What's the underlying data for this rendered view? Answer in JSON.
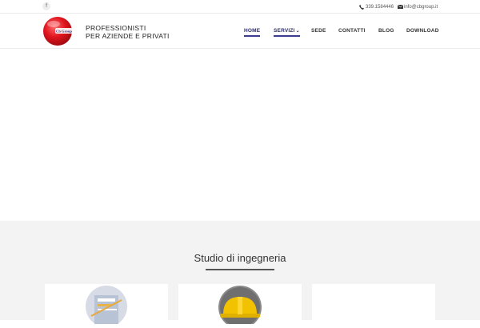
{
  "topbar": {
    "facebook_icon": "facebook-icon",
    "phone": "339.1584446",
    "email": "info@cbgroup.it"
  },
  "header": {
    "logo_text": "Cb Group",
    "tagline_line1": "PROFESSIONISTI",
    "tagline_line2": "PER AZIENDE E PRIVATI",
    "nav": {
      "home": "HOME",
      "servizi": "SERVIZI",
      "sede": "SEDE",
      "contatti": "CONTATTI",
      "blog": "BLOG",
      "download": "DOWNLOAD"
    }
  },
  "section": {
    "title": "Studio di ingegneria"
  },
  "colors": {
    "accent": "#3b3b8f",
    "logo_red": "#e0141e",
    "section_bg": "#f3f3f3"
  }
}
